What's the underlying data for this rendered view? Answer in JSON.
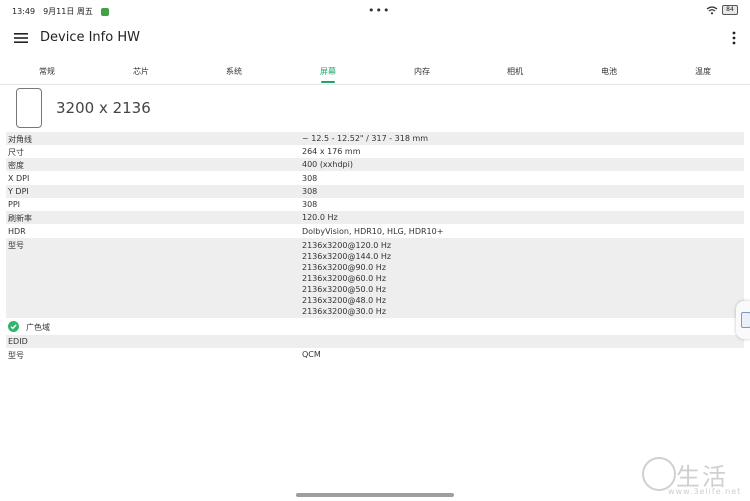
{
  "status_bar": {
    "time": "13:49",
    "date": "9月11日 周五",
    "center_dots": "•••",
    "battery": "84",
    "icons": [
      "app-notification-icon",
      "wifi-icon",
      "battery-icon"
    ]
  },
  "app_bar": {
    "title": "Device Info HW",
    "menu_icon": "hamburger-menu-icon",
    "more_icon": "more-vertical-icon"
  },
  "tabs": [
    {
      "label": "常规"
    },
    {
      "label": "芯片"
    },
    {
      "label": "系统"
    },
    {
      "label": "屏幕",
      "active": true
    },
    {
      "label": "内存"
    },
    {
      "label": "相机"
    },
    {
      "label": "电池"
    },
    {
      "label": "温度"
    }
  ],
  "accent_color": "#20a46e",
  "screen": {
    "resolution": "3200 x 2136",
    "rows": {
      "diagonal": {
        "label": "对角线",
        "value": "~ 12.5 - 12.52\" / 317 - 318 mm"
      },
      "size": {
        "label": "尺寸",
        "value": "264 x 176 mm"
      },
      "density": {
        "label": "密度",
        "value": "400 (xxhdpi)"
      },
      "xdpi": {
        "label": "X DPI",
        "value": "308"
      },
      "ydpi": {
        "label": "Y DPI",
        "value": "308"
      },
      "ppi": {
        "label": "PPI",
        "value": "308"
      },
      "refresh": {
        "label": "刷新率",
        "value": "120.0 Hz"
      },
      "hdr": {
        "label": "HDR",
        "value": "DolbyVision, HDR10, HLG, HDR10+"
      },
      "modes": {
        "label": "型号",
        "values": [
          "2136x3200@120.0 Hz",
          "2136x3200@144.0 Hz",
          "2136x3200@90.0 Hz",
          "2136x3200@60.0 Hz",
          "2136x3200@50.0 Hz",
          "2136x3200@48.0 Hz",
          "2136x3200@30.0 Hz"
        ]
      },
      "wide_gamut": {
        "label": "广色域"
      },
      "edid": {
        "label": "EDID"
      },
      "model": {
        "label": "型号",
        "value": "QCM"
      }
    }
  },
  "watermark": {
    "text": "生活",
    "url": "www.3elife.net"
  }
}
